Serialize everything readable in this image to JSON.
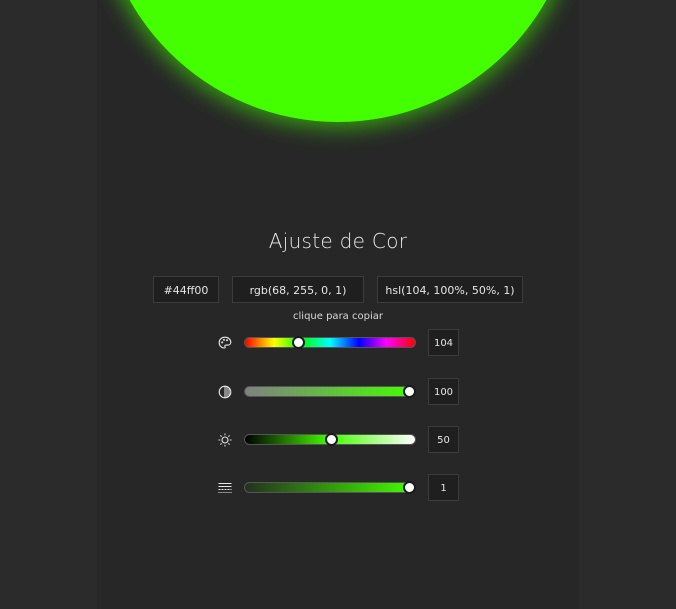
{
  "color": {
    "hex_value": "#44ff00",
    "accent": "#44ff00"
  },
  "title": "Ajuste de Cor",
  "copy_boxes": {
    "hex": "#44ff00",
    "rgb": "rgb(68, 255, 0, 1)",
    "hsl": "hsl(104, 100%, 50%, 1)"
  },
  "hint": "clique para copiar",
  "sliders": [
    {
      "name": "hue",
      "icon": "palette-icon",
      "value": "104",
      "level": 0.289
    },
    {
      "name": "saturation",
      "icon": "contrast-icon",
      "value": "100",
      "level": 1.0
    },
    {
      "name": "lightness",
      "icon": "sun-icon",
      "value": "50",
      "level": 0.5
    },
    {
      "name": "alpha",
      "icon": "opacity-icon",
      "value": "1",
      "level": 1.0
    }
  ]
}
